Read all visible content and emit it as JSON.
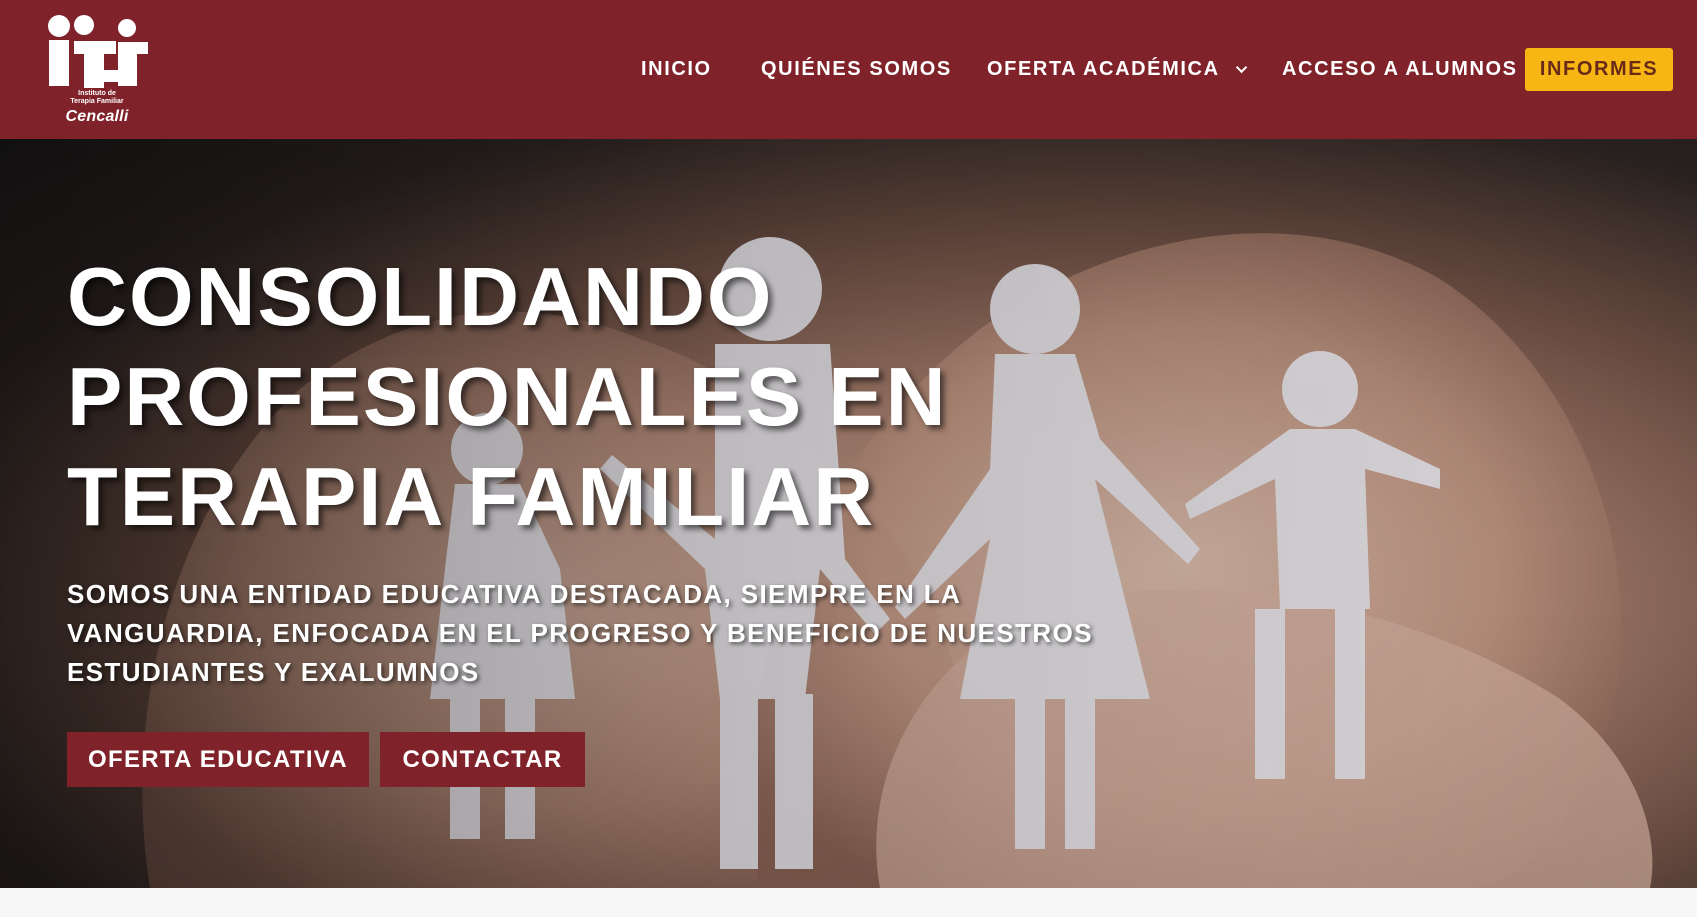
{
  "brand": {
    "logo_mark": "iti",
    "logo_small_line1": "Instituto de",
    "logo_small_line2": "Terapia Familiar",
    "logo_name": "Cencalli",
    "header_color": "#7f2229",
    "accent_color": "#f7b614"
  },
  "nav": {
    "items": [
      {
        "label": "INICIO"
      },
      {
        "label": "QUIÉNES SOMOS"
      },
      {
        "label": "OFERTA ACADÉMICA",
        "has_dropdown": true,
        "icon": "chevron-down-icon"
      },
      {
        "label": "ACCESO A ALUMNOS"
      }
    ],
    "cta_label": "INFORMES"
  },
  "hero": {
    "title_line1": "CONSOLIDANDO",
    "title_line2": "PROFESIONALES EN",
    "title_line3": "TERAPIA FAMILIAR",
    "subtitle_line1": "SOMOS UNA ENTIDAD EDUCATIVA DESTACADA, SIEMPRE EN LA",
    "subtitle_line2": "VANGUARDIA, ENFOCADA EN EL PROGRESO Y BENEFICIO DE NUESTROS",
    "subtitle_line3": "ESTUDIANTES Y EXALUMNOS",
    "button_primary": "OFERTA EDUCATIVA",
    "button_secondary": "CONTACTAR",
    "image_subject": "hands-holding-paper-family"
  }
}
